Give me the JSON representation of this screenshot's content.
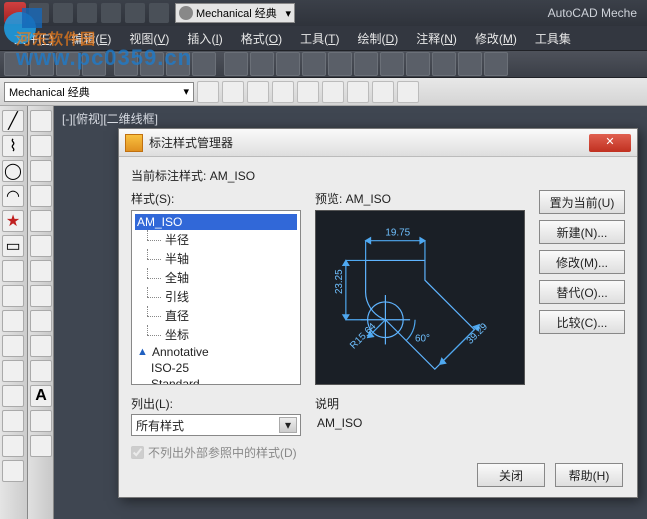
{
  "app": {
    "title": "AutoCAD Meche"
  },
  "workspace_combo": "Mechanical 经典",
  "menu": [
    {
      "label": "文件",
      "key": "F"
    },
    {
      "label": "编辑",
      "key": "E"
    },
    {
      "label": "视图",
      "key": "V"
    },
    {
      "label": "插入",
      "key": "I"
    },
    {
      "label": "格式",
      "key": "O"
    },
    {
      "label": "工具",
      "key": "T"
    },
    {
      "label": "绘制",
      "key": "D"
    },
    {
      "label": "注释",
      "key": "N"
    },
    {
      "label": "修改",
      "key": "M"
    },
    {
      "label": "工具集"
    }
  ],
  "layer_combo": "Mechanical 经典",
  "viewport_label": "[-][俯视][二维线框]",
  "dialog": {
    "title": "标注样式管理器",
    "current_label": "当前标注样式:",
    "current_value": "AM_ISO",
    "styles_label": "样式(S):",
    "styles": {
      "root": "AM_ISO",
      "children": [
        "半径",
        "半轴",
        "全轴",
        "引线",
        "直径",
        "坐标"
      ],
      "annotative": "Annotative",
      "iso25": "ISO-25",
      "standard": "Standard"
    },
    "preview_label": "预览: AM_ISO",
    "preview_dims": {
      "top": "19.75",
      "left": "23.25",
      "radius": "R15.64",
      "angle": "60°",
      "diag": "39.29"
    },
    "list_label": "列出(L):",
    "list_value": "所有样式",
    "xref_checkbox": "不列出外部参照中的样式(D)",
    "desc_label": "说明",
    "desc_value": "AM_ISO",
    "buttons": {
      "set_current": "置为当前(U)",
      "new": "新建(N)...",
      "modify": "修改(M)...",
      "override": "替代(O)...",
      "compare": "比较(C)..."
    },
    "footer": {
      "close": "关闭",
      "help": "帮助(H)"
    }
  },
  "watermark": "www.pc0359.cn",
  "watermark_prefix": "河东软件园"
}
